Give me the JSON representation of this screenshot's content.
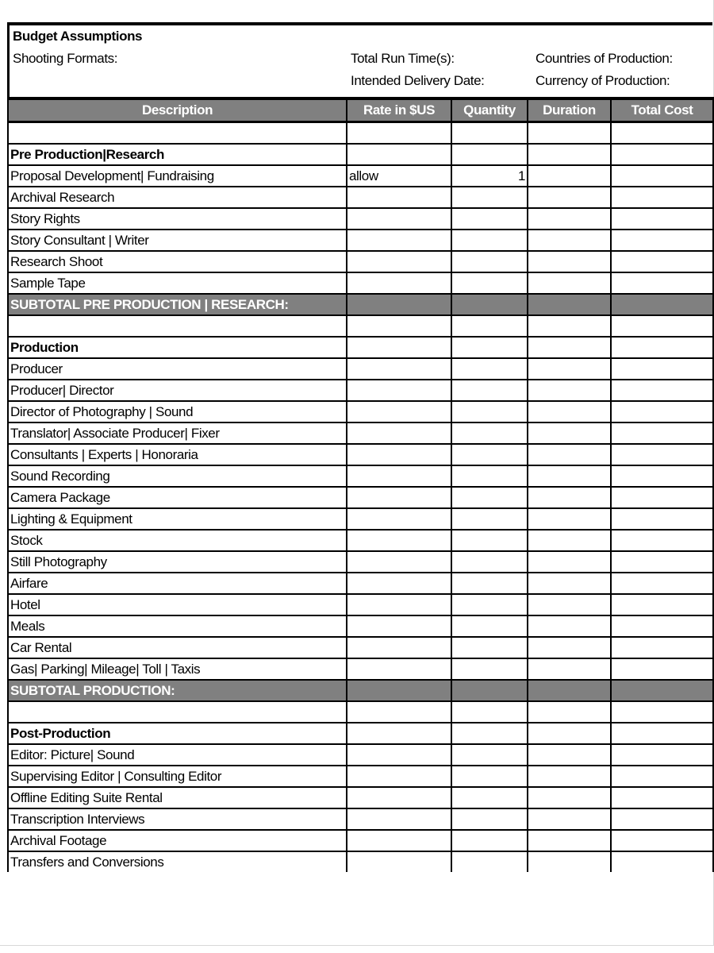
{
  "assumptions": {
    "title": "Budget Assumptions",
    "shooting_formats": "Shooting Formats:",
    "total_run_time": "Total Run Time(s):",
    "intended_delivery_date": "Intended Delivery Date:",
    "countries_of_production": "Countries of Production:",
    "currency_of_production": "Currency of Production:"
  },
  "table": {
    "columns": [
      "Description",
      "Rate in $US",
      "Quantity",
      "Duration",
      "Total Cost"
    ],
    "rows": [
      {
        "type": "blank",
        "cells": [
          "",
          "",
          "",
          "",
          ""
        ]
      },
      {
        "type": "section",
        "cells": [
          "Pre Production|Research",
          "",
          "",
          "",
          ""
        ]
      },
      {
        "type": "item",
        "cells": [
          "Proposal Development| Fundraising",
          "allow",
          "1",
          "",
          ""
        ]
      },
      {
        "type": "item",
        "cells": [
          "Archival Research",
          "",
          "",
          "",
          ""
        ]
      },
      {
        "type": "item",
        "cells": [
          "Story Rights",
          "",
          "",
          "",
          ""
        ]
      },
      {
        "type": "item",
        "cells": [
          "Story Consultant | Writer",
          "",
          "",
          "",
          ""
        ]
      },
      {
        "type": "item",
        "cells": [
          "Research Shoot",
          "",
          "",
          "",
          ""
        ]
      },
      {
        "type": "item",
        "cells": [
          "Sample Tape",
          "",
          "",
          "",
          ""
        ]
      },
      {
        "type": "subtotal",
        "cells": [
          "SUBTOTAL PRE PRODUCTION | RESEARCH:",
          "",
          "",
          "",
          ""
        ]
      },
      {
        "type": "blank",
        "cells": [
          "",
          "",
          "",
          "",
          ""
        ]
      },
      {
        "type": "section",
        "cells": [
          "Production",
          "",
          "",
          "",
          ""
        ]
      },
      {
        "type": "item",
        "cells": [
          "Producer",
          "",
          "",
          "",
          ""
        ]
      },
      {
        "type": "item",
        "cells": [
          "Producer| Director",
          "",
          "",
          "",
          ""
        ]
      },
      {
        "type": "item",
        "cells": [
          "Director of Photography | Sound",
          "",
          "",
          "",
          ""
        ]
      },
      {
        "type": "item",
        "cells": [
          "Translator| Associate Producer| Fixer",
          "",
          "",
          "",
          ""
        ]
      },
      {
        "type": "item",
        "cells": [
          "Consultants | Experts | Honoraria",
          "",
          "",
          "",
          ""
        ]
      },
      {
        "type": "item",
        "cells": [
          "Sound Recording",
          "",
          "",
          "",
          ""
        ]
      },
      {
        "type": "item",
        "cells": [
          "Camera Package",
          "",
          "",
          "",
          ""
        ]
      },
      {
        "type": "item",
        "cells": [
          "Lighting & Equipment",
          "",
          "",
          "",
          ""
        ]
      },
      {
        "type": "item",
        "cells": [
          "Stock",
          "",
          "",
          "",
          ""
        ]
      },
      {
        "type": "item",
        "cells": [
          "Still Photography",
          "",
          "",
          "",
          ""
        ]
      },
      {
        "type": "item",
        "cells": [
          "Airfare",
          "",
          "",
          "",
          ""
        ]
      },
      {
        "type": "item",
        "cells": [
          "Hotel",
          "",
          "",
          "",
          ""
        ]
      },
      {
        "type": "item",
        "cells": [
          "Meals",
          "",
          "",
          "",
          ""
        ]
      },
      {
        "type": "item",
        "cells": [
          "Car Rental",
          "",
          "",
          "",
          ""
        ]
      },
      {
        "type": "item",
        "cells": [
          "Gas| Parking| Mileage| Toll | Taxis",
          "",
          "",
          "",
          ""
        ]
      },
      {
        "type": "subtotal",
        "cells": [
          "SUBTOTAL PRODUCTION:",
          "",
          "",
          "",
          ""
        ]
      },
      {
        "type": "blank",
        "cells": [
          "",
          "",
          "",
          "",
          ""
        ]
      },
      {
        "type": "section",
        "cells": [
          "Post-Production",
          "",
          "",
          "",
          ""
        ]
      },
      {
        "type": "item",
        "cells": [
          "Editor: Picture| Sound",
          "",
          "",
          "",
          ""
        ]
      },
      {
        "type": "item",
        "cells": [
          "Supervising Editor | Consulting Editor",
          "",
          "",
          "",
          ""
        ]
      },
      {
        "type": "item",
        "cells": [
          "Offline Editing Suite Rental",
          "",
          "",
          "",
          ""
        ]
      },
      {
        "type": "item",
        "cells": [
          "Transcription Interviews",
          "",
          "",
          "",
          ""
        ]
      },
      {
        "type": "item",
        "cells": [
          "Archival Footage",
          "",
          "",
          "",
          ""
        ]
      },
      {
        "type": "item",
        "cells": [
          "Transfers and Conversions",
          "",
          "",
          "",
          ""
        ]
      }
    ]
  },
  "colors": {
    "header_fill": "#808080",
    "header_text": "#ffffff",
    "border": "#000000"
  }
}
